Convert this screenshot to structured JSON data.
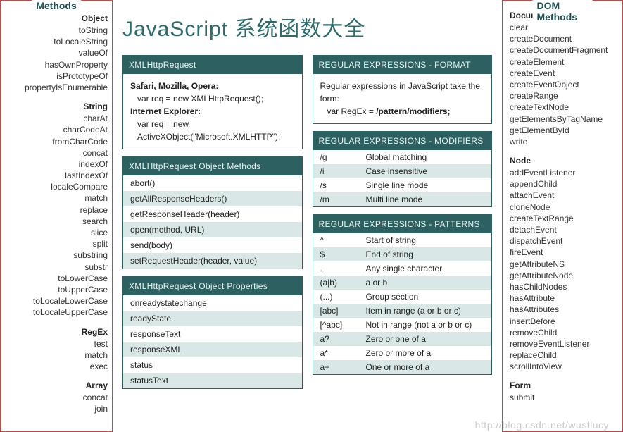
{
  "title": "JavaScript 系统函数大全",
  "watermark": "http://blog.csdn.net/wustlucy",
  "leftSidebar": {
    "title": "Methods",
    "groups": [
      {
        "title": "Object",
        "items": [
          "toString",
          "toLocaleString",
          "valueOf",
          "hasOwnProperty",
          "isPrototypeOf",
          "propertyIsEnumerable"
        ]
      },
      {
        "title": "String",
        "items": [
          "charAt",
          "charCodeAt",
          "fromCharCode",
          "concat",
          "indexOf",
          "lastIndexOf",
          "localeCompare",
          "match",
          "replace",
          "search",
          "slice",
          "split",
          "substring",
          "substr",
          "toLowerCase",
          "toUpperCase",
          "toLocaleLowerCase",
          "toLocaleUpperCase"
        ]
      },
      {
        "title": "RegEx",
        "items": [
          "test",
          "match",
          "exec"
        ]
      },
      {
        "title": "Array",
        "items": [
          "concat",
          "join"
        ]
      }
    ]
  },
  "rightSidebar": {
    "title": "DOM Methods",
    "groups": [
      {
        "title": "Document",
        "items": [
          "clear",
          "createDocument",
          "createDocumentFragment",
          "createElement",
          "createEvent",
          "createEventObject",
          "createRange",
          "createTextNode",
          "getElementsByTagName",
          "getElementById",
          "write"
        ]
      },
      {
        "title": "Node",
        "items": [
          "addEventListener",
          "appendChild",
          "attachEvent",
          "cloneNode",
          "createTextRange",
          "detachEvent",
          "dispatchEvent",
          "fireEvent",
          "getAttributeNS",
          "getAttributeNode",
          "hasChildNodes",
          "hasAttribute",
          "hasAttributes",
          "insertBefore",
          "removeChild",
          "removeEventListener",
          "replaceChild",
          "scrollIntoView"
        ]
      },
      {
        "title": "Form",
        "items": [
          "submit"
        ]
      }
    ]
  },
  "leftCol": {
    "xhrIntro": {
      "header": "XMLHttpRequest",
      "safariLabel": "Safari, Mozilla, Opera:",
      "safariCode": "var req = new XMLHttpRequest();",
      "ieLabel": "Internet Explorer:",
      "ieCode1": "var req = new",
      "ieCode2": "ActiveXObject(\"Microsoft.XMLHTTP\");"
    },
    "xhrMethods": {
      "header": "XMLHttpRequest Object Methods",
      "items": [
        "abort()",
        "getAllResponseHeaders()",
        "getResponseHeader(header)",
        "open(method, URL)",
        "send(body)",
        "setRequestHeader(header, value)"
      ]
    },
    "xhrProps": {
      "header": "XMLHttpRequest Object Properties",
      "items": [
        "onreadystatechange",
        "readyState",
        "responseText",
        "responseXML",
        "status",
        "statusText"
      ]
    }
  },
  "rightCol": {
    "reFormat": {
      "header": "REGULAR EXPRESSIONS - FORMAT",
      "line1": "Regular expressions in JavaScript take the form:",
      "line2a": "var RegEx = ",
      "line2b": "/pattern/modifiers;"
    },
    "reModifiers": {
      "header": "REGULAR EXPRESSIONS - MODIFIERS",
      "pairs": [
        {
          "k": "/g",
          "v": "Global matching"
        },
        {
          "k": "/i",
          "v": "Case insensitive"
        },
        {
          "k": "/s",
          "v": "Single line mode"
        },
        {
          "k": "/m",
          "v": "Multi line mode"
        }
      ]
    },
    "rePatterns": {
      "header": "REGULAR EXPRESSIONS - PATTERNS",
      "pairs": [
        {
          "k": "^",
          "v": "Start of string"
        },
        {
          "k": "$",
          "v": "End of string"
        },
        {
          "k": ".",
          "v": "Any single character"
        },
        {
          "k": "(a|b)",
          "v": "a or b"
        },
        {
          "k": "(...)",
          "v": "Group section"
        },
        {
          "k": "[abc]",
          "v": "Item in range (a or b or c)"
        },
        {
          "k": "[^abc]",
          "v": "Not in range (not a or b or c)"
        },
        {
          "k": "a?",
          "v": "Zero or one of a"
        },
        {
          "k": "a*",
          "v": "Zero or more of a"
        },
        {
          "k": "a+",
          "v": "One or more of a"
        }
      ]
    }
  }
}
